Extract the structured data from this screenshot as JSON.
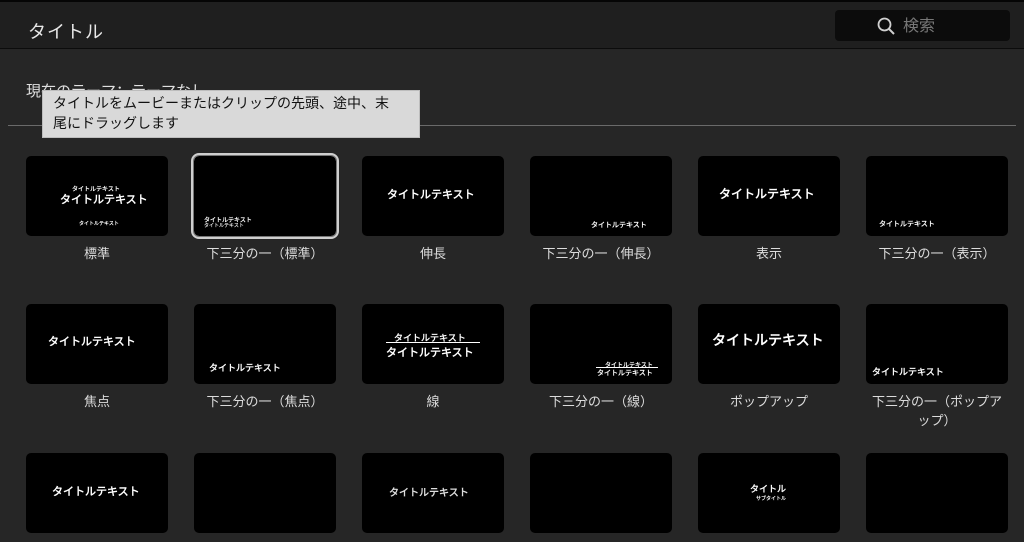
{
  "header": {
    "title": "タイトル",
    "search_placeholder": "検索"
  },
  "theme_label": "現在のテーマ：テーマなし",
  "tooltip": {
    "line1": "タイトルをムービーまたはクリップの先頭、途中、末",
    "line2": "尾にドラッグします"
  },
  "tiles": [
    {
      "label": "標準",
      "preview": [
        "タイトルテキスト",
        "タイトルテキスト",
        "タイトルテキスト"
      ]
    },
    {
      "label": "下三分の一（標準）",
      "preview": [
        "タイトルテキスト",
        "タイトルテキスト"
      ]
    },
    {
      "label": "伸長",
      "preview": [
        "タイトルテキスト"
      ]
    },
    {
      "label": "下三分の一（伸長）",
      "preview": [
        "タイトルテキスト"
      ]
    },
    {
      "label": "表示",
      "preview": [
        "タイトルテキスト"
      ]
    },
    {
      "label": "下三分の一（表示）",
      "preview": [
        "タイトルテキスト"
      ]
    },
    {
      "label": "焦点",
      "preview": [
        "タイトルテキスト"
      ]
    },
    {
      "label": "下三分の一（焦点）",
      "preview": [
        "タイトルテキスト"
      ]
    },
    {
      "label": "線",
      "preview": [
        "タイトルテキスト",
        "タイトルテキスト"
      ]
    },
    {
      "label": "下三分の一（線）",
      "preview": [
        "タイトルテキスト",
        "タイトルテキスト"
      ]
    },
    {
      "label": "ポップアップ",
      "preview": [
        "タイトルテキスト"
      ]
    },
    {
      "label": "下三分の一（ポップアップ）",
      "preview": [
        "タイトルテキスト"
      ]
    },
    {
      "label": "",
      "preview": [
        "タイトルテキスト"
      ]
    },
    {
      "label": "",
      "preview": []
    },
    {
      "label": "",
      "preview": [
        "タイトルテキスト"
      ]
    },
    {
      "label": "",
      "preview": []
    },
    {
      "label": "",
      "preview": [
        "タイトル",
        "サブタイトル"
      ]
    },
    {
      "label": "",
      "preview": []
    }
  ]
}
